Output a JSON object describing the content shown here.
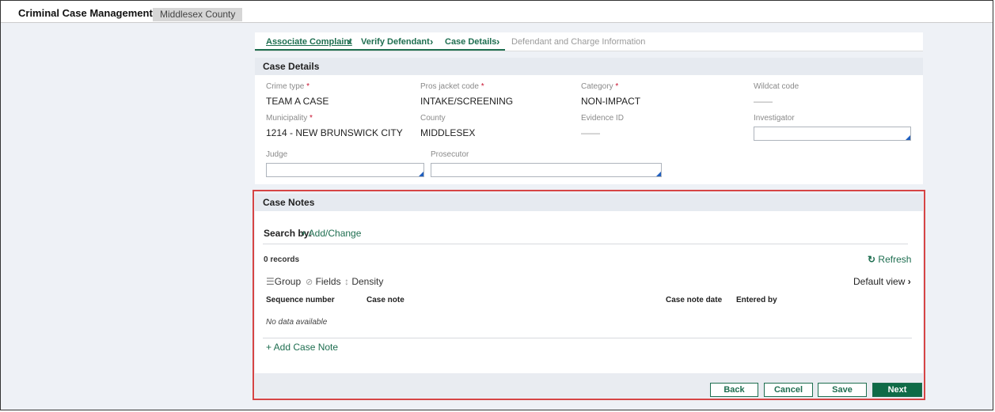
{
  "app": {
    "title": "Criminal Case Management",
    "county": "Middlesex County"
  },
  "steps": [
    {
      "label": "Associate Complaint"
    },
    {
      "label": "Verify Defendant"
    },
    {
      "label": "Case Details"
    },
    {
      "label": "Defendant and Charge Information"
    }
  ],
  "case_details": {
    "header": "Case Details",
    "crime_type": {
      "label": "Crime type",
      "value": "TEAM A CASE"
    },
    "pros_jacket_code": {
      "label": "Pros jacket code",
      "value": "INTAKE/SCREENING"
    },
    "category": {
      "label": "Category",
      "value": "NON-IMPACT"
    },
    "wildcat_code": {
      "label": "Wildcat code",
      "value": "——"
    },
    "municipality": {
      "label": "Municipality",
      "value": "1214 - NEW BRUNSWICK CITY"
    },
    "county": {
      "label": "County",
      "value": "MIDDLESEX"
    },
    "evidence_id": {
      "label": "Evidence ID",
      "value": "——"
    },
    "investigator": {
      "label": "Investigator",
      "value": ""
    },
    "judge": {
      "label": "Judge",
      "value": ""
    },
    "prosecutor": {
      "label": "Prosecutor",
      "value": ""
    },
    "required_mark": "*"
  },
  "case_notes": {
    "header": "Case Notes",
    "search_by": "Search by:",
    "add_change": "+ Add/Change",
    "records": "0 records",
    "refresh": "Refresh",
    "group": "Group",
    "fields": "Fields",
    "density": "Density",
    "default_view": "Default view",
    "columns": [
      "Sequence number",
      "Case note",
      "Case note date",
      "Entered by"
    ],
    "empty": "No data available",
    "add_note": "+ Add Case Note"
  },
  "buttons": {
    "back": "Back",
    "cancel": "Cancel",
    "save": "Save",
    "next": "Next"
  }
}
